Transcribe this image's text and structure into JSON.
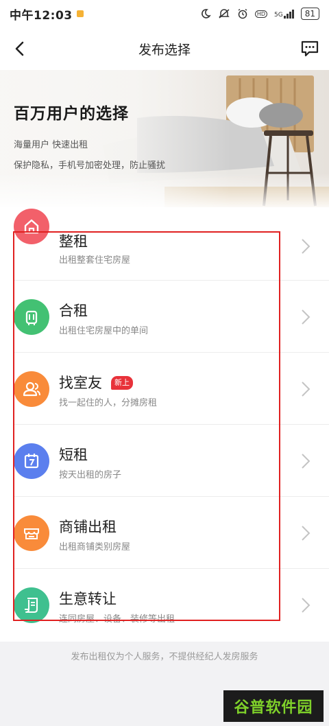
{
  "status_bar": {
    "time": "中午12:03",
    "network": "5G",
    "battery": "81"
  },
  "nav": {
    "title": "发布选择",
    "back_icon": "chevron-left-icon",
    "message_icon": "message-icon"
  },
  "banner": {
    "title": "百万用户的选择",
    "line1": "海量用户   快速出租",
    "line2": "保护隐私，手机号加密处理，防止骚扰"
  },
  "options": [
    {
      "title": "整租",
      "desc": "出租整套住宅房屋",
      "icon": "house-icon",
      "color": "#f2606a",
      "badge": ""
    },
    {
      "title": "合租",
      "desc": "出租住宅房屋中的单间",
      "icon": "luggage-icon",
      "color": "#43c173",
      "badge": ""
    },
    {
      "title": "找室友",
      "desc": "找一起住的人，分摊房租",
      "icon": "people-icon",
      "color": "#f98b3a",
      "badge": "新上"
    },
    {
      "title": "短租",
      "desc": "按天出租的房子",
      "icon": "calendar-icon",
      "color": "#5b7fee",
      "badge": ""
    },
    {
      "title": "商铺出租",
      "desc": "出租商铺类别房屋",
      "icon": "shop-icon",
      "color": "#f98b3a",
      "badge": ""
    },
    {
      "title": "生意转让",
      "desc": "连同房屋、设备、装修等出租",
      "icon": "contract-icon",
      "color": "#3fc08f",
      "badge": ""
    }
  ],
  "footer_note": "发布出租仅为个人服务，不提供经纪人发房服务",
  "watermark": "谷普软件园"
}
